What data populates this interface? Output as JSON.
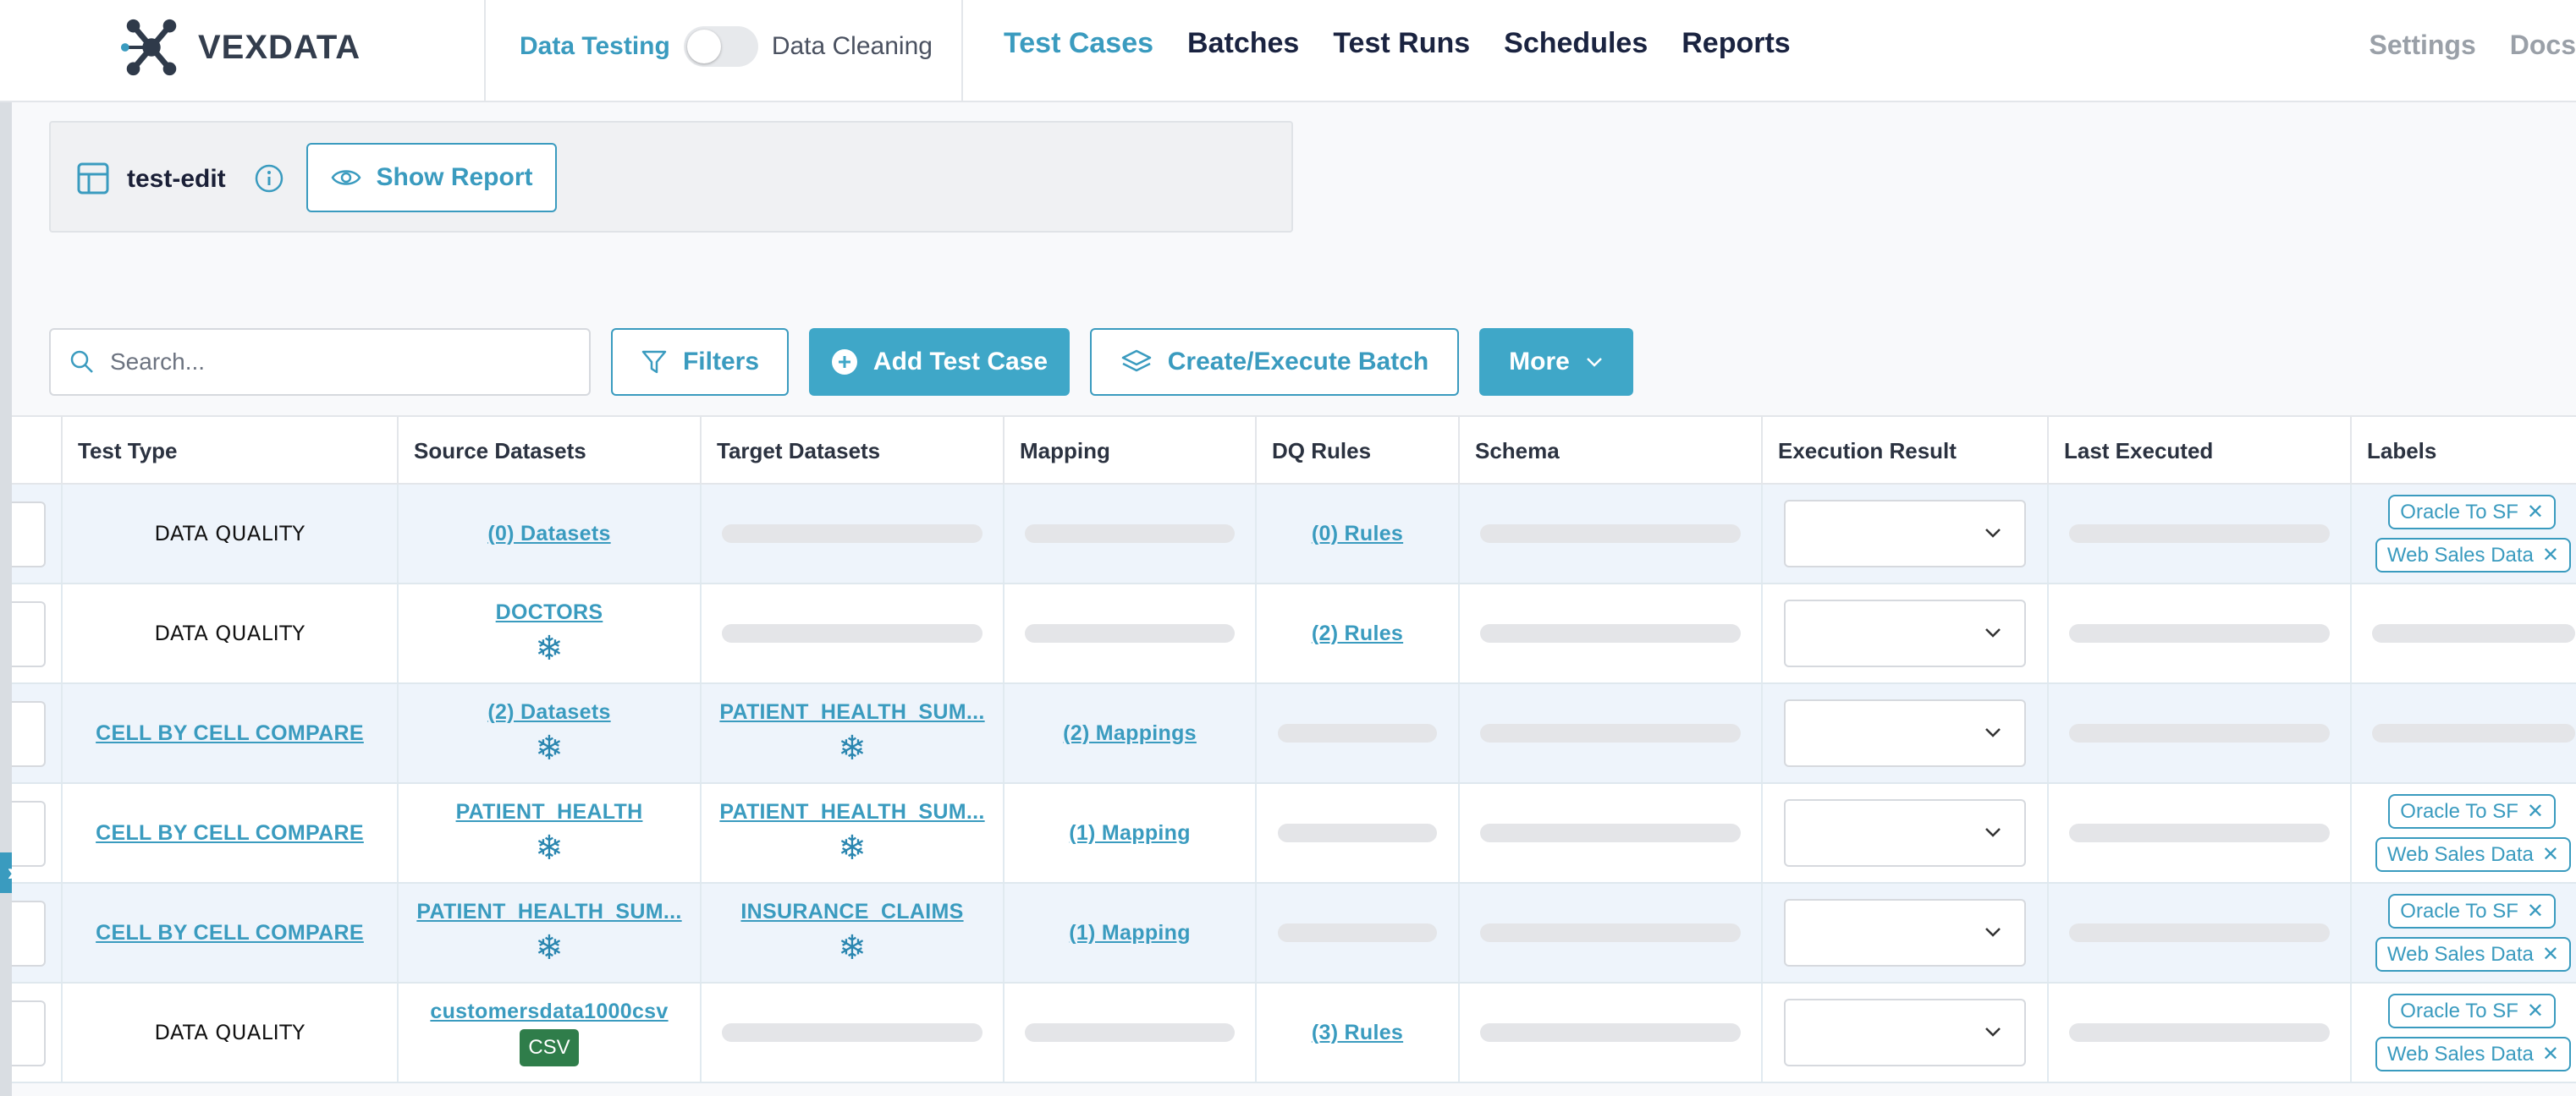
{
  "brand": {
    "name": "VEXDATA"
  },
  "mode": {
    "left": "Data Testing",
    "right": "Data Cleaning"
  },
  "nav": {
    "items": [
      "Test Cases",
      "Batches",
      "Test Runs",
      "Schedules",
      "Reports"
    ],
    "active": "Test Cases"
  },
  "nav_right": [
    "Settings",
    "Docs"
  ],
  "header": {
    "name": "test-edit",
    "show_report": "Show Report"
  },
  "toolbar": {
    "search_placeholder": "Search...",
    "filters": "Filters",
    "add_test_case": "Add Test Case",
    "create_execute_batch": "Create/Execute Batch",
    "more": "More"
  },
  "table": {
    "columns": [
      "Test Type",
      "Source Datasets",
      "Target Datasets",
      "Mapping",
      "DQ Rules",
      "Schema",
      "Execution Result",
      "Last Executed",
      "Labels"
    ],
    "rows": [
      {
        "test_type": "DATA QUALITY",
        "test_type_link": false,
        "source": "(0) Datasets",
        "source_icon": "",
        "target": "",
        "target_icon": "",
        "mapping": "",
        "dq_rules": "(0) Rules",
        "labels": [
          "Oracle To SF",
          "Web Sales Data"
        ]
      },
      {
        "test_type": "DATA QUALITY",
        "test_type_link": false,
        "source": "DOCTORS",
        "source_icon": "snowflake-icon",
        "target": "",
        "target_icon": "",
        "mapping": "",
        "dq_rules": "(2) Rules",
        "labels": []
      },
      {
        "test_type": "CELL BY CELL COMPARE",
        "test_type_link": true,
        "source": "(2) Datasets",
        "source_icon": "snowflake-icon",
        "target": "PATIENT_HEALTH_SUM...",
        "target_icon": "snowflake-icon",
        "mapping": "(2) Mappings",
        "dq_rules": "",
        "labels": []
      },
      {
        "test_type": "CELL BY CELL COMPARE",
        "test_type_link": true,
        "source": "PATIENT_HEALTH",
        "source_icon": "snowflake-icon",
        "target": "PATIENT_HEALTH_SUM...",
        "target_icon": "snowflake-icon",
        "mapping": "(1) Mapping",
        "dq_rules": "",
        "labels": [
          "Oracle To SF",
          "Web Sales Data"
        ]
      },
      {
        "test_type": "CELL BY CELL COMPARE",
        "test_type_link": true,
        "source": "PATIENT_HEALTH_SUM...",
        "source_icon": "snowflake-icon",
        "target": "INSURANCE_CLAIMS",
        "target_icon": "snowflake-icon",
        "mapping": "(1) Mapping",
        "dq_rules": "",
        "labels": [
          "Oracle To SF",
          "Web Sales Data"
        ]
      },
      {
        "test_type": "DATA QUALITY",
        "test_type_link": false,
        "source": "customersdata1000csv",
        "source_icon": "csv-icon",
        "source_badge": "CSV",
        "target": "",
        "target_icon": "",
        "mapping": "",
        "dq_rules": "(3) Rules",
        "labels": [
          "Oracle To SF",
          "Web Sales Data"
        ]
      }
    ]
  },
  "colors": {
    "accent": "#3a9bbf",
    "accent_solid": "#3fa7c8",
    "nav_text": "#1a2340",
    "csv_badge": "#2f7d4a"
  }
}
